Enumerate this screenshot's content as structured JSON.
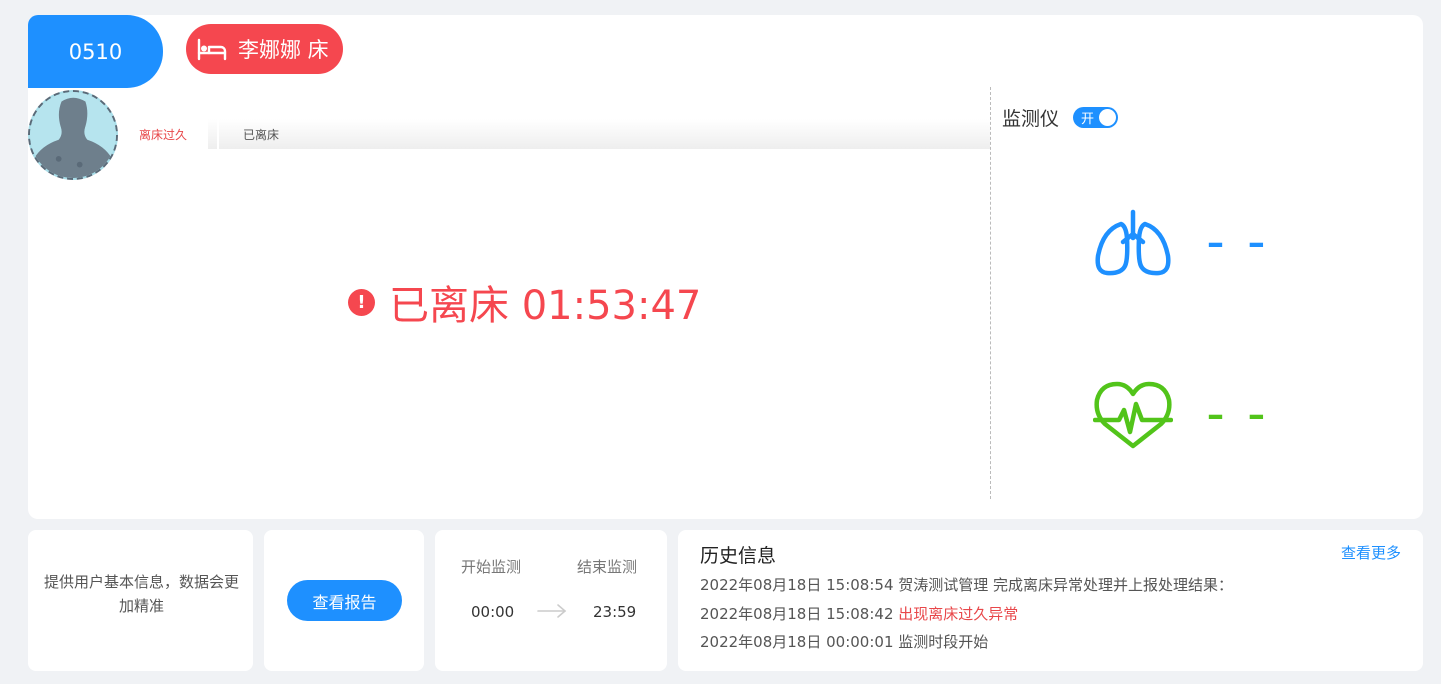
{
  "room": {
    "number": "0510"
  },
  "patient": {
    "name": "李娜娜 床",
    "icon": "bed-icon"
  },
  "status": {
    "warn_tab": "离床过久",
    "current_tab": "已离床"
  },
  "alert": {
    "text": "已离床 01:53:47",
    "icon": "alert-icon",
    "color": "#f5474f"
  },
  "monitor": {
    "label": "监测仪",
    "toggle_text": "开",
    "respiration": {
      "icon": "lungs-icon",
      "value": "– –",
      "color": "#1e90ff"
    },
    "heart": {
      "icon": "heart-pulse-icon",
      "value": "– –",
      "color": "#52c41a"
    }
  },
  "profile_tip": {
    "text": "提供用户基本信息，数据会更加精准"
  },
  "report": {
    "button_label": "查看报告"
  },
  "schedule": {
    "start_label": "开始监测",
    "end_label": "结束监测",
    "start_time": "00:00",
    "end_time": "23:59"
  },
  "history": {
    "title": "历史信息",
    "more_label": "查看更多",
    "entries": [
      {
        "time": "2022年08月18日 15:08:54",
        "text": "贺涛测试管理 完成离床异常处理并上报处理结果：",
        "highlight": ""
      },
      {
        "time": "2022年08月18日 15:08:42",
        "text": "",
        "highlight": "出现离床过久异常"
      },
      {
        "time": "2022年08月18日 00:00:01",
        "text": "监测时段开始",
        "highlight": ""
      }
    ]
  }
}
